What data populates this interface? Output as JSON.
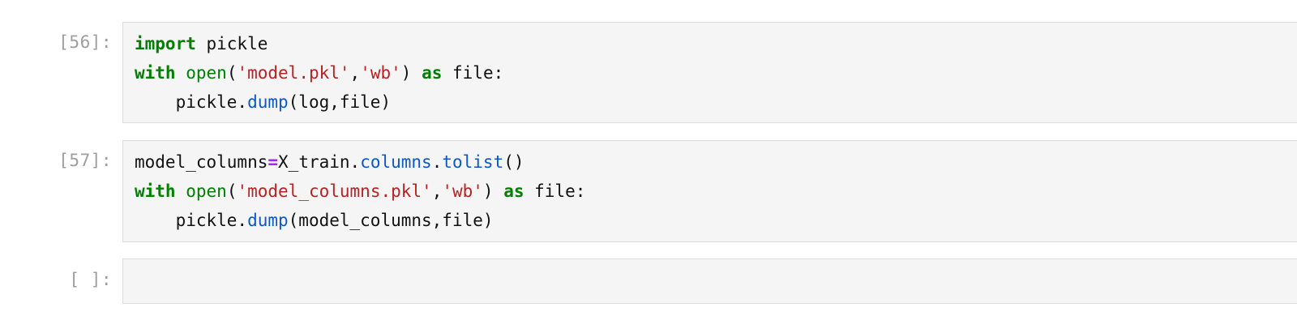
{
  "cells": [
    {
      "prompt": "[56]:",
      "lines": [
        [
          {
            "text": "import",
            "type": "kw"
          },
          {
            "text": " pickle",
            "type": "plain"
          }
        ],
        [
          {
            "text": "with",
            "type": "kw"
          },
          {
            "text": " ",
            "type": "plain"
          },
          {
            "text": "open",
            "type": "bi"
          },
          {
            "text": "(",
            "type": "plain"
          },
          {
            "text": "'model.pkl'",
            "type": "str"
          },
          {
            "text": ",",
            "type": "plain"
          },
          {
            "text": "'wb'",
            "type": "str"
          },
          {
            "text": ") ",
            "type": "plain"
          },
          {
            "text": "as",
            "type": "kw"
          },
          {
            "text": " file:",
            "type": "plain"
          }
        ],
        [
          {
            "text": "    pickle.",
            "type": "plain"
          },
          {
            "text": "dump",
            "type": "attr"
          },
          {
            "text": "(log,file)",
            "type": "plain"
          }
        ]
      ]
    },
    {
      "prompt": "[57]:",
      "lines": [
        [
          {
            "text": "model_columns",
            "type": "plain"
          },
          {
            "text": "=",
            "type": "op"
          },
          {
            "text": "X_train.",
            "type": "plain"
          },
          {
            "text": "columns",
            "type": "attr"
          },
          {
            "text": ".",
            "type": "plain"
          },
          {
            "text": "tolist",
            "type": "attr"
          },
          {
            "text": "()",
            "type": "plain"
          }
        ],
        [
          {
            "text": "with",
            "type": "kw"
          },
          {
            "text": " ",
            "type": "plain"
          },
          {
            "text": "open",
            "type": "bi"
          },
          {
            "text": "(",
            "type": "plain"
          },
          {
            "text": "'model_columns.pkl'",
            "type": "str"
          },
          {
            "text": ",",
            "type": "plain"
          },
          {
            "text": "'wb'",
            "type": "str"
          },
          {
            "text": ") ",
            "type": "plain"
          },
          {
            "text": "as",
            "type": "kw"
          },
          {
            "text": " file:",
            "type": "plain"
          }
        ],
        [
          {
            "text": "    pickle.",
            "type": "plain"
          },
          {
            "text": "dump",
            "type": "attr"
          },
          {
            "text": "(model_columns,file)",
            "type": "plain"
          }
        ]
      ]
    },
    {
      "prompt": "[ ]:",
      "lines": []
    }
  ]
}
